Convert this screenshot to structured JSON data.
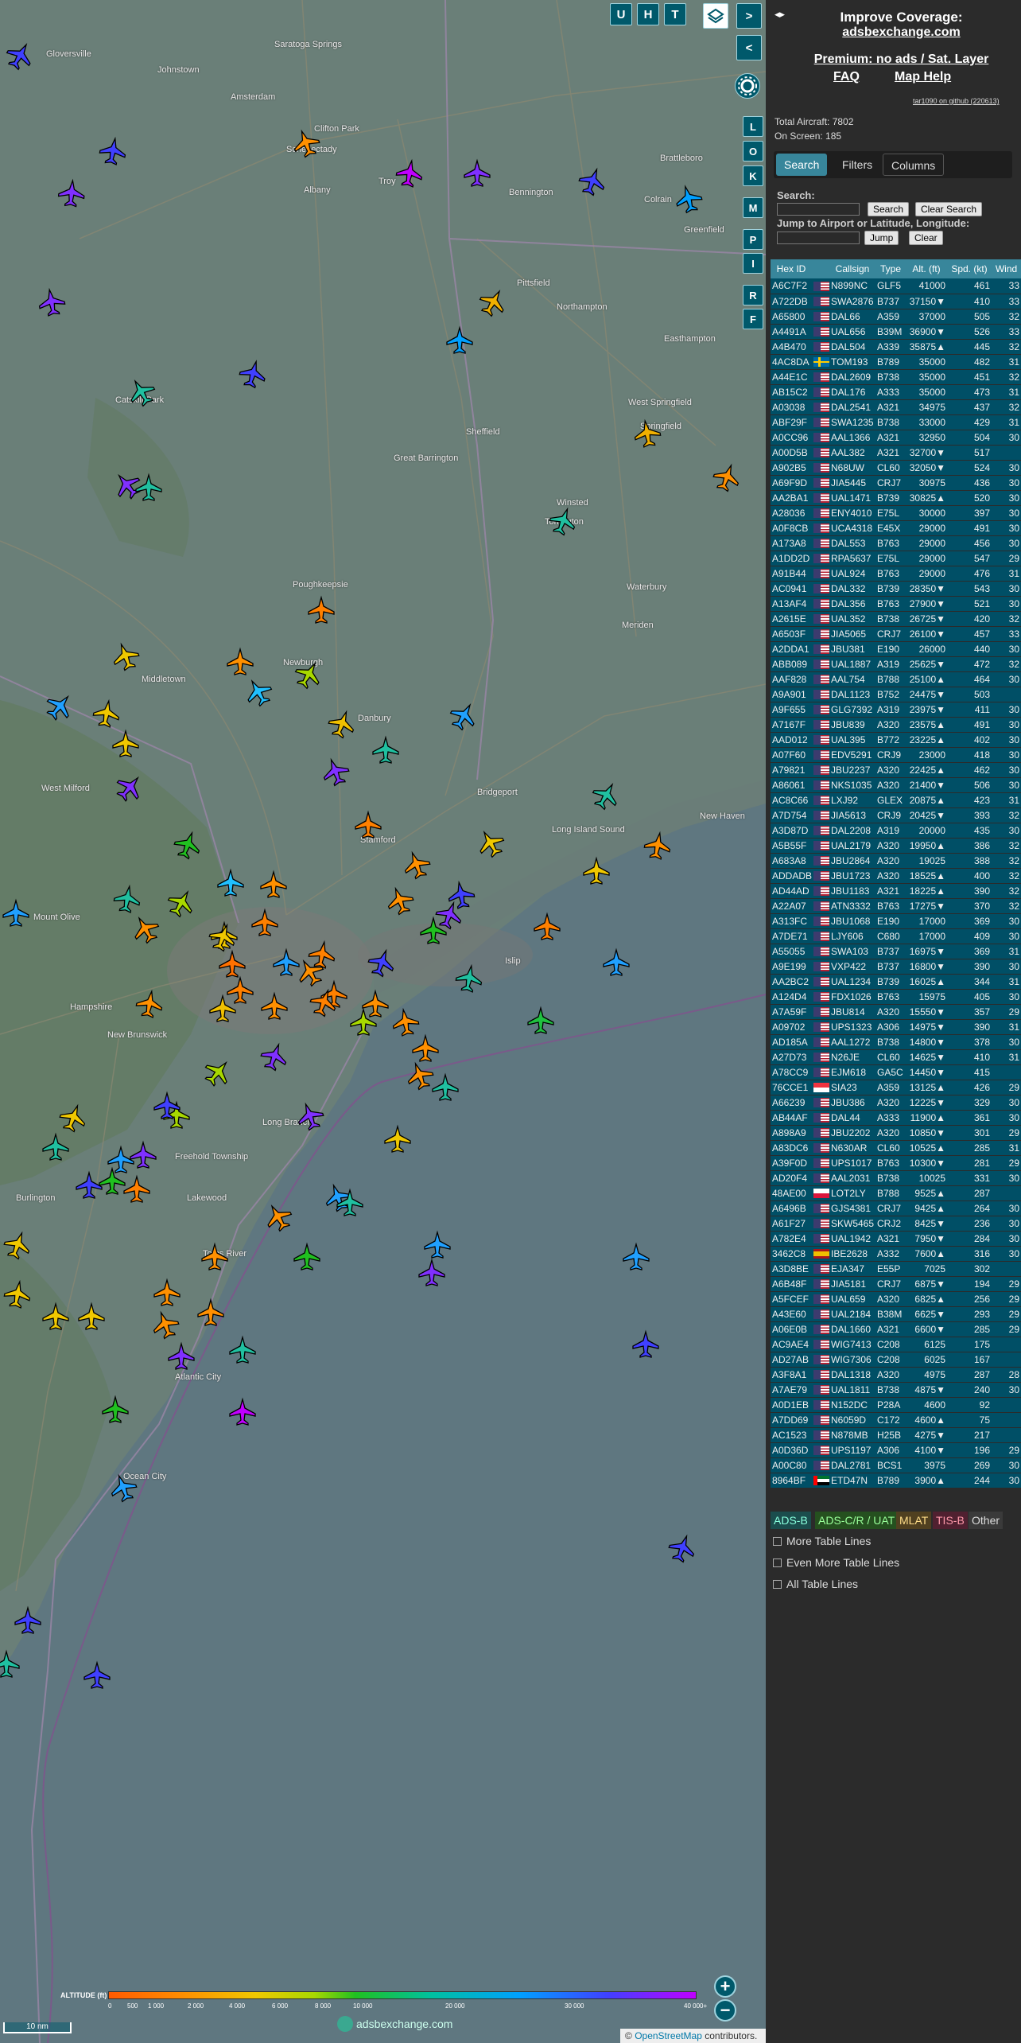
{
  "map": {
    "buttons": {
      "u": "U",
      "h": "H",
      "t": "T",
      "next": ">",
      "prev": "<",
      "toggle": "◂▸"
    },
    "side_buttons": [
      "L",
      "O",
      "K",
      "M",
      "P",
      "I",
      "R",
      "F"
    ],
    "places": [
      "Gloversville",
      "Johnstown",
      "Amsterdam",
      "Saratoga Springs",
      "Schenectady",
      "Clifton Park",
      "Troy",
      "Albany",
      "Bennington",
      "Brattleboro",
      "Colrain",
      "Greenfield",
      "Pittsfield",
      "Northampton",
      "Easthampton",
      "West Springfield",
      "Springfield",
      "Catskill Park",
      "Sheffield",
      "Great Barrington",
      "Winsted",
      "Torrington",
      "Poughkeepsie",
      "Newburgh",
      "Middletown",
      "Danbury",
      "Waterbury",
      "Meriden",
      "Bridgeport",
      "New Haven",
      "Stamford",
      "Long Island Sound",
      "West Milford",
      "Islip",
      "Mount Olive",
      "New Brunswick",
      "Long Branch",
      "Freehold Township",
      "Lakewood",
      "Toms River",
      "Atlantic City",
      "Ocean City",
      "Burlington",
      "Hampshire"
    ],
    "altitude_legend": {
      "title": "ALTITUDE (ft)",
      "ticks": [
        "0",
        "500",
        "1 000",
        "2 000",
        "4 000",
        "6 000",
        "8 000",
        "10 000",
        "20 000",
        "30 000",
        "40 000+"
      ]
    },
    "scale": "10 nm",
    "watermark": "adsbexchange.com",
    "attribution": {
      "prefix": "©",
      "link": "OpenStreetMap",
      "suffix": "contributors."
    },
    "zoom_in": "+",
    "zoom_out": "−"
  },
  "panel": {
    "improve": "Improve Coverage:",
    "site": "adsbexchange.com",
    "premium": "Premium: no ads / Sat. Layer",
    "faq": "FAQ",
    "help": "Map Help",
    "version": "tar1090 on github (220613)",
    "total": "Total Aircraft: 7802",
    "onscreen": "On Screen: 185",
    "tabs": {
      "search": "Search",
      "filters": "Filters",
      "columns": "Columns"
    },
    "search_label": "Search:",
    "search_btn": "Search",
    "clear_btn": "Clear Search",
    "jump_label": "Jump to Airport or Latitude, Longitude:",
    "jump_btn": "Jump",
    "clear2_btn": "Clear",
    "legend": {
      "adsb": "ADS-B",
      "adsc": "ADS-C/R / UAT",
      "mlat": "MLAT",
      "tisb": "TIS-B",
      "other": "Other"
    },
    "checks": {
      "more": "More Table Lines",
      "even": "Even More Table Lines",
      "all": "All Table Lines"
    }
  },
  "table": {
    "headers": [
      "Hex ID",
      "",
      "Callsign",
      "Type",
      "Alt. (ft)",
      "Spd. (kt)",
      "Wind"
    ],
    "rows": [
      [
        "A6C7F2",
        "us",
        "N899NC",
        "GLF5",
        "41000",
        "461",
        "33"
      ],
      [
        "A722DB",
        "us",
        "SWA2876",
        "B737",
        "37150▼",
        "410",
        "33"
      ],
      [
        "A65800",
        "us",
        "DAL66",
        "A359",
        "37000",
        "505",
        "32"
      ],
      [
        "A4491A",
        "us",
        "UAL656",
        "B39M",
        "36900▼",
        "526",
        "33"
      ],
      [
        "A4B470",
        "us",
        "DAL504",
        "A339",
        "35875▲",
        "445",
        "32"
      ],
      [
        "4AC8DA",
        "se",
        "TOM193",
        "B789",
        "35000",
        "482",
        "31"
      ],
      [
        "A44E1C",
        "us",
        "DAL2609",
        "B738",
        "35000",
        "451",
        "32"
      ],
      [
        "AB15C2",
        "us",
        "DAL176",
        "A333",
        "35000",
        "473",
        "31"
      ],
      [
        "A03038",
        "us",
        "DAL2541",
        "A321",
        "34975",
        "437",
        "32"
      ],
      [
        "ABF29F",
        "us",
        "SWA1235",
        "B738",
        "33000",
        "429",
        "31"
      ],
      [
        "A0CC96",
        "us",
        "AAL1366",
        "A321",
        "32950",
        "504",
        "30"
      ],
      [
        "A00D5B",
        "us",
        "AAL382",
        "A321",
        "32700▼",
        "517",
        ""
      ],
      [
        "A902B5",
        "us",
        "N68UW",
        "CL60",
        "32050▼",
        "524",
        "30"
      ],
      [
        "A69F9D",
        "us",
        "JIA5445",
        "CRJ7",
        "30975",
        "436",
        "30"
      ],
      [
        "AA2BA1",
        "us",
        "UAL1471",
        "B739",
        "30825▲",
        "520",
        "30"
      ],
      [
        "A28036",
        "us",
        "ENY4010",
        "E75L",
        "30000",
        "397",
        "30"
      ],
      [
        "A0F8CB",
        "us",
        "UCA4318",
        "E45X",
        "29000",
        "491",
        "30"
      ],
      [
        "A173A8",
        "us",
        "DAL553",
        "B763",
        "29000",
        "456",
        "30"
      ],
      [
        "A1DD2D",
        "us",
        "RPA5637",
        "E75L",
        "29000",
        "547",
        "29"
      ],
      [
        "A91B44",
        "us",
        "UAL924",
        "B763",
        "29000",
        "476",
        "31"
      ],
      [
        "AC0941",
        "us",
        "DAL332",
        "B739",
        "28350▼",
        "543",
        "30"
      ],
      [
        "A13AF4",
        "us",
        "DAL356",
        "B763",
        "27900▼",
        "521",
        "30"
      ],
      [
        "A2615E",
        "us",
        "UAL352",
        "B738",
        "26725▼",
        "420",
        "32"
      ],
      [
        "A6503F",
        "us",
        "JIA5065",
        "CRJ7",
        "26100▼",
        "457",
        "33"
      ],
      [
        "A2DDA1",
        "us",
        "JBU381",
        "E190",
        "26000",
        "440",
        "30"
      ],
      [
        "ABB089",
        "us",
        "UAL1887",
        "A319",
        "25625▼",
        "472",
        "32"
      ],
      [
        "AAF828",
        "us",
        "AAL754",
        "B788",
        "25100▲",
        "464",
        "30"
      ],
      [
        "A9A901",
        "us",
        "DAL1123",
        "B752",
        "24475▼",
        "503",
        ""
      ],
      [
        "A9F655",
        "us",
        "GLG7392",
        "A319",
        "23975▼",
        "411",
        "30"
      ],
      [
        "A7167F",
        "us",
        "JBU839",
        "A320",
        "23575▲",
        "491",
        "30"
      ],
      [
        "AAD012",
        "us",
        "UAL395",
        "B772",
        "23225▲",
        "402",
        "30"
      ],
      [
        "A07F60",
        "us",
        "EDV5291",
        "CRJ9",
        "23000",
        "418",
        "30"
      ],
      [
        "A79821",
        "us",
        "JBU2237",
        "A320",
        "22425▲",
        "462",
        "30"
      ],
      [
        "A86061",
        "us",
        "NKS1035",
        "A320",
        "21400▼",
        "506",
        "30"
      ],
      [
        "AC8C66",
        "us",
        "LXJ92",
        "GLEX",
        "20875▲",
        "423",
        "31"
      ],
      [
        "A7D754",
        "us",
        "JIA5613",
        "CRJ9",
        "20425▼",
        "393",
        "32"
      ],
      [
        "A3D87D",
        "us",
        "DAL2208",
        "A319",
        "20000",
        "435",
        "30"
      ],
      [
        "A5B55F",
        "us",
        "UAL2179",
        "A320",
        "19950▲",
        "386",
        "32"
      ],
      [
        "A683A8",
        "us",
        "JBU2864",
        "A320",
        "19025",
        "388",
        "32"
      ],
      [
        "ADDADB",
        "us",
        "JBU1723",
        "A320",
        "18525▲",
        "400",
        "32"
      ],
      [
        "AD44AD",
        "us",
        "JBU1183",
        "A321",
        "18225▲",
        "390",
        "32"
      ],
      [
        "A22A07",
        "us",
        "ATN3332",
        "B763",
        "17275▼",
        "370",
        "32"
      ],
      [
        "A313FC",
        "us",
        "JBU1068",
        "E190",
        "17000",
        "369",
        "30"
      ],
      [
        "A7DE71",
        "us",
        "LJY606",
        "C680",
        "17000",
        "409",
        "30"
      ],
      [
        "A55055",
        "us",
        "SWA103",
        "B737",
        "16975▼",
        "369",
        "31"
      ],
      [
        "A9E199",
        "us",
        "VXP422",
        "B737",
        "16800▼",
        "390",
        "30"
      ],
      [
        "AA2BC2",
        "us",
        "UAL1234",
        "B739",
        "16025▲",
        "344",
        "31"
      ],
      [
        "A124D4",
        "us",
        "FDX1026",
        "B763",
        "15975",
        "405",
        "30"
      ],
      [
        "A7A59F",
        "us",
        "JBU814",
        "A320",
        "15550▼",
        "357",
        "29"
      ],
      [
        "A09702",
        "us",
        "UPS1323",
        "A306",
        "14975▼",
        "390",
        "31"
      ],
      [
        "AD185A",
        "us",
        "AAL1272",
        "B738",
        "14800▼",
        "378",
        "30"
      ],
      [
        "A27D73",
        "us",
        "N26JE",
        "CL60",
        "14625▼",
        "410",
        "31"
      ],
      [
        "A78CC9",
        "us",
        "EJM618",
        "GA5C",
        "14450▼",
        "415",
        ""
      ],
      [
        "76CCE1",
        "sg",
        "SIA23",
        "A359",
        "13125▲",
        "426",
        "29"
      ],
      [
        "A66239",
        "us",
        "JBU386",
        "A320",
        "12225▼",
        "329",
        "30"
      ],
      [
        "AB44AF",
        "us",
        "DAL44",
        "A333",
        "11900▲",
        "361",
        "30"
      ],
      [
        "A898A9",
        "us",
        "JBU2202",
        "A320",
        "10850▼",
        "301",
        "29"
      ],
      [
        "A83DC6",
        "us",
        "N630AR",
        "CL60",
        "10525▲",
        "285",
        "31"
      ],
      [
        "A39F0D",
        "us",
        "UPS1017",
        "B763",
        "10300▼",
        "281",
        "29"
      ],
      [
        "AD20F4",
        "us",
        "AAL2031",
        "B738",
        "10025",
        "331",
        "30"
      ],
      [
        "48AE00",
        "pl",
        "LOT2LY",
        "B788",
        "9525▲",
        "287",
        ""
      ],
      [
        "A6496B",
        "us",
        "GJS4381",
        "CRJ7",
        "9425▲",
        "264",
        "30"
      ],
      [
        "A61F27",
        "us",
        "SKW5465",
        "CRJ2",
        "8425▼",
        "236",
        "30"
      ],
      [
        "A782E4",
        "us",
        "UAL1942",
        "A321",
        "7950▼",
        "284",
        "30"
      ],
      [
        "3462C8",
        "es",
        "IBE2628",
        "A332",
        "7600▲",
        "316",
        "30"
      ],
      [
        "A3D8BE",
        "us",
        "EJA347",
        "E55P",
        "7025",
        "302",
        ""
      ],
      [
        "A6B48F",
        "us",
        "JIA5181",
        "CRJ7",
        "6875▼",
        "194",
        "29"
      ],
      [
        "A5FCEF",
        "us",
        "UAL659",
        "A320",
        "6825▲",
        "256",
        "29"
      ],
      [
        "A43E60",
        "us",
        "UAL2184",
        "B38M",
        "6625▼",
        "293",
        "29"
      ],
      [
        "A06E0B",
        "us",
        "DAL1660",
        "A321",
        "6600▼",
        "285",
        "29"
      ],
      [
        "AC9AE4",
        "us",
        "WIG7413",
        "C208",
        "6125",
        "175",
        ""
      ],
      [
        "AD27AB",
        "us",
        "WIG7306",
        "C208",
        "6025",
        "167",
        ""
      ],
      [
        "A3F8A1",
        "us",
        "DAL1318",
        "A320",
        "4975",
        "287",
        "28"
      ],
      [
        "A7AE79",
        "us",
        "UAL1811",
        "B738",
        "4875▼",
        "240",
        "30"
      ],
      [
        "A0D1EB",
        "us",
        "N152DC",
        "P28A",
        "4600",
        "92",
        ""
      ],
      [
        "A7DD69",
        "us",
        "N6059D",
        "C172",
        "4600▲",
        "75",
        ""
      ],
      [
        "AC1523",
        "us",
        "N878MB",
        "H25B",
        "4275▼",
        "217",
        ""
      ],
      [
        "A0D36D",
        "us",
        "UPS1197",
        "A306",
        "4100▼",
        "196",
        "29"
      ],
      [
        "A00C80",
        "us",
        "DAL2781",
        "BCS1",
        "3975",
        "269",
        "30"
      ],
      [
        "8964BF",
        "ae",
        "ETD47N",
        "B789",
        "3900▲",
        "244",
        "30"
      ]
    ]
  }
}
